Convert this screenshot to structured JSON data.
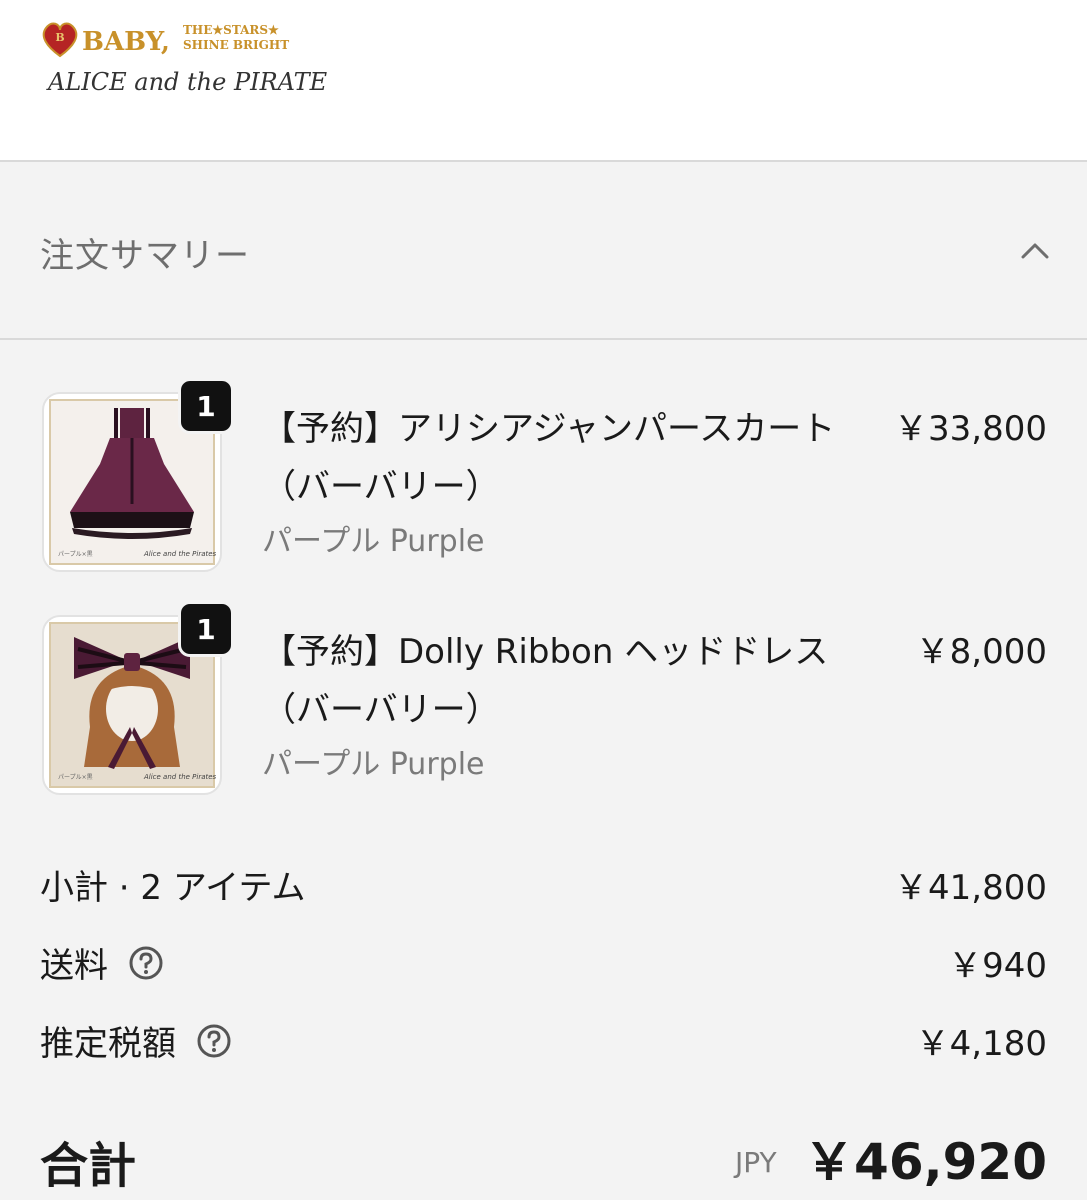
{
  "brand": {
    "logo_line1": "BABY,",
    "logo_line2": "THE★STARS★",
    "logo_line3": "SHINE BRIGHT",
    "logo_line4": "ALICE and the PIRATES"
  },
  "summary": {
    "title": "注文サマリー",
    "expanded": true
  },
  "items": [
    {
      "name": "【予約】アリシアジャンパースカート（バーバリー）",
      "variant": "パープル Purple",
      "price": "￥33,800",
      "quantity": "1"
    },
    {
      "name": "【予約】Dolly Ribbon ヘッドドレス（バーバリー）",
      "variant": "パープル Purple",
      "price": "￥8,000",
      "quantity": "1"
    }
  ],
  "totals": {
    "subtotal_label": "小計 · 2 アイテム",
    "subtotal_value": "￥41,800",
    "shipping_label": "送料",
    "shipping_value": "￥940",
    "tax_label": "推定税額",
    "tax_value": "￥4,180",
    "total_label": "合計",
    "total_currency": "JPY",
    "total_value": "￥46,920"
  },
  "colors": {
    "background": "#f3f3f3",
    "header_bg": "#ffffff",
    "badge_bg": "#111111",
    "logo_gold": "#c8912a",
    "logo_red": "#b52424",
    "dress_purple": "#6a2848"
  }
}
